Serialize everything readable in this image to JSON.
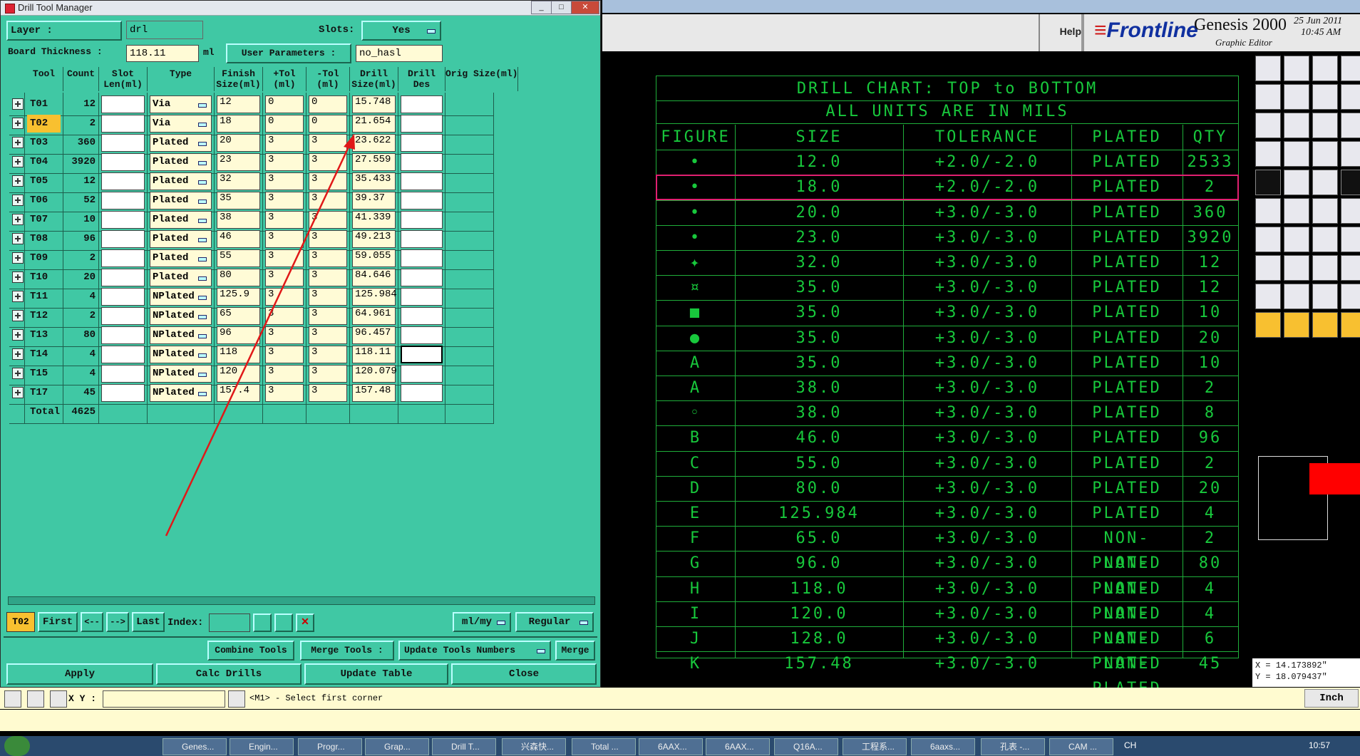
{
  "dialog": {
    "title": "Drill Tool Manager",
    "window_buttons": [
      "_",
      "□",
      "✕"
    ],
    "layer_label": "Layer :",
    "layer_value": "drl",
    "slots_label": "Slots:",
    "slots_value": "Yes",
    "board_thickness_label": "Board Thickness :",
    "board_thickness_value": "118.11",
    "board_thickness_unit": "ml",
    "user_parameters_label": "User Parameters :",
    "user_parameters_value": "no_hasl",
    "columns": [
      "Tool",
      "Count",
      "Slot Len(ml)",
      "Type",
      "Finish Size(ml)",
      "+Tol (ml)",
      "-Tol (ml)",
      "Drill Size(ml)",
      "Drill Des",
      "Orig Size(ml)"
    ],
    "rows": [
      {
        "tool": "T01",
        "count": "12",
        "type": "Via",
        "finish": "12",
        "ptol": "0",
        "mtol": "0",
        "drill": "15.748"
      },
      {
        "tool": "T02",
        "count": "2",
        "type": "Via",
        "finish": "18",
        "ptol": "0",
        "mtol": "0",
        "drill": "21.654"
      },
      {
        "tool": "T03",
        "count": "360",
        "type": "Plated",
        "finish": "20",
        "ptol": "3",
        "mtol": "3",
        "drill": "23.622"
      },
      {
        "tool": "T04",
        "count": "3920",
        "type": "Plated",
        "finish": "23",
        "ptol": "3",
        "mtol": "3",
        "drill": "27.559"
      },
      {
        "tool": "T05",
        "count": "12",
        "type": "Plated",
        "finish": "32",
        "ptol": "3",
        "mtol": "3",
        "drill": "35.433"
      },
      {
        "tool": "T06",
        "count": "52",
        "type": "Plated",
        "finish": "35",
        "ptol": "3",
        "mtol": "3",
        "drill": "39.37"
      },
      {
        "tool": "T07",
        "count": "10",
        "type": "Plated",
        "finish": "38",
        "ptol": "3",
        "mtol": "3",
        "drill": "41.339"
      },
      {
        "tool": "T08",
        "count": "96",
        "type": "Plated",
        "finish": "46",
        "ptol": "3",
        "mtol": "3",
        "drill": "49.213"
      },
      {
        "tool": "T09",
        "count": "2",
        "type": "Plated",
        "finish": "55",
        "ptol": "3",
        "mtol": "3",
        "drill": "59.055"
      },
      {
        "tool": "T10",
        "count": "20",
        "type": "Plated",
        "finish": "80",
        "ptol": "3",
        "mtol": "3",
        "drill": "84.646"
      },
      {
        "tool": "T11",
        "count": "4",
        "type": "NPlated",
        "finish": "125.9",
        "ptol": "3",
        "mtol": "3",
        "drill": "125.984"
      },
      {
        "tool": "T12",
        "count": "2",
        "type": "NPlated",
        "finish": "65",
        "ptol": "3",
        "mtol": "3",
        "drill": "64.961"
      },
      {
        "tool": "T13",
        "count": "80",
        "type": "NPlated",
        "finish": "96",
        "ptol": "3",
        "mtol": "3",
        "drill": "96.457"
      },
      {
        "tool": "T14",
        "count": "4",
        "type": "NPlated",
        "finish": "118",
        "ptol": "3",
        "mtol": "3",
        "drill": "118.11"
      },
      {
        "tool": "T15",
        "count": "4",
        "type": "NPlated",
        "finish": "120",
        "ptol": "3",
        "mtol": "3",
        "drill": "120.079"
      },
      {
        "tool": "T17",
        "count": "45",
        "type": "NPlated",
        "finish": "157.4",
        "ptol": "3",
        "mtol": "3",
        "drill": "157.48"
      }
    ],
    "total_label": "Total",
    "total_count": "4625",
    "nav": {
      "current_tool": "T02",
      "first": "First",
      "prev": "<--",
      "next": "-->",
      "last": "Last",
      "index_label": "Index:",
      "unit_select": "ml/my",
      "mode_select": "Regular"
    },
    "actions1": {
      "combine": "Combine Tools",
      "merge_tools": "Merge Tools :",
      "update_numbers": "Update Tools Numbers",
      "merge": "Merge"
    },
    "actions2": {
      "apply": "Apply",
      "calc": "Calc Drills",
      "update_table": "Update Table",
      "close": "Close"
    }
  },
  "genesis": {
    "help": "Help",
    "brand": "Frontline",
    "product": "Genesis 2000",
    "subtitle": "Graphic Editor",
    "date": "25 Jun 2011",
    "time": "10:45 AM"
  },
  "drill_chart": {
    "title1": "DRILL CHART: TOP to BOTTOM",
    "title2": "ALL UNITS ARE IN MILS",
    "headers": [
      "FIGURE",
      "SIZE",
      "TOLERANCE",
      "PLATED",
      "QTY"
    ],
    "rows": [
      {
        "fig": "•",
        "size": "12.0",
        "tol": "+2.0/-2.0",
        "plated": "PLATED",
        "qty": "2533"
      },
      {
        "fig": "•",
        "size": "18.0",
        "tol": "+2.0/-2.0",
        "plated": "PLATED",
        "qty": "2"
      },
      {
        "fig": "•",
        "size": "20.0",
        "tol": "+3.0/-3.0",
        "plated": "PLATED",
        "qty": "360"
      },
      {
        "fig": "•",
        "size": "23.0",
        "tol": "+3.0/-3.0",
        "plated": "PLATED",
        "qty": "3920"
      },
      {
        "fig": "✦",
        "size": "32.0",
        "tol": "+3.0/-3.0",
        "plated": "PLATED",
        "qty": "12"
      },
      {
        "fig": "¤",
        "size": "35.0",
        "tol": "+3.0/-3.0",
        "plated": "PLATED",
        "qty": "12"
      },
      {
        "fig": "■",
        "size": "35.0",
        "tol": "+3.0/-3.0",
        "plated": "PLATED",
        "qty": "10"
      },
      {
        "fig": "●",
        "size": "35.0",
        "tol": "+3.0/-3.0",
        "plated": "PLATED",
        "qty": "20"
      },
      {
        "fig": "A",
        "size": "35.0",
        "tol": "+3.0/-3.0",
        "plated": "PLATED",
        "qty": "10"
      },
      {
        "fig": "A",
        "size": "38.0",
        "tol": "+3.0/-3.0",
        "plated": "PLATED",
        "qty": "2"
      },
      {
        "fig": "◦",
        "size": "38.0",
        "tol": "+3.0/-3.0",
        "plated": "PLATED",
        "qty": "8"
      },
      {
        "fig": "B",
        "size": "46.0",
        "tol": "+3.0/-3.0",
        "plated": "PLATED",
        "qty": "96"
      },
      {
        "fig": "C",
        "size": "55.0",
        "tol": "+3.0/-3.0",
        "plated": "PLATED",
        "qty": "2"
      },
      {
        "fig": "D",
        "size": "80.0",
        "tol": "+3.0/-3.0",
        "plated": "PLATED",
        "qty": "20"
      },
      {
        "fig": "E",
        "size": "125.984",
        "tol": "+3.0/-3.0",
        "plated": "PLATED",
        "qty": "4"
      },
      {
        "fig": "F",
        "size": "65.0",
        "tol": "+3.0/-3.0",
        "plated": "NON-PLATED",
        "qty": "2"
      },
      {
        "fig": "G",
        "size": "96.0",
        "tol": "+3.0/-3.0",
        "plated": "NON-PLATED",
        "qty": "80"
      },
      {
        "fig": "H",
        "size": "118.0",
        "tol": "+3.0/-3.0",
        "plated": "NON-PLATED",
        "qty": "4"
      },
      {
        "fig": "I",
        "size": "120.0",
        "tol": "+3.0/-3.0",
        "plated": "NON-PLATED",
        "qty": "4"
      },
      {
        "fig": "J",
        "size": "128.0",
        "tol": "+3.0/-3.0",
        "plated": "NON-PLATED",
        "qty": "6"
      },
      {
        "fig": "K",
        "size": "157.48",
        "tol": "+3.0/-3.0",
        "plated": "NON-PLATED",
        "qty": "45"
      }
    ]
  },
  "coords": {
    "x": "X = 14.173892\"",
    "y": "Y = 18.079437\""
  },
  "status": {
    "xy_label": "X Y :",
    "prompt": "<M1> - Select first corner",
    "unit": "Inch"
  },
  "taskbar": {
    "items": [
      "Genes...",
      "Engin...",
      "Progr...",
      "Grap...",
      "Drill T...",
      "兴森快...",
      "Total ...",
      "6AAX...",
      "6AAX...",
      "Q16A...",
      "工程系...",
      "6aaxs...",
      "孔表 -...",
      "CAM ..."
    ],
    "clock": "10:57",
    "lang": "CH"
  },
  "colors": {
    "dialog_bg": "#40c8a4",
    "field_bg": "#fffbd6",
    "chart_green": "#18c83c",
    "highlight": "#e02070",
    "selected_tool": "#f8c030",
    "annotation_arrow": "#e01818"
  }
}
